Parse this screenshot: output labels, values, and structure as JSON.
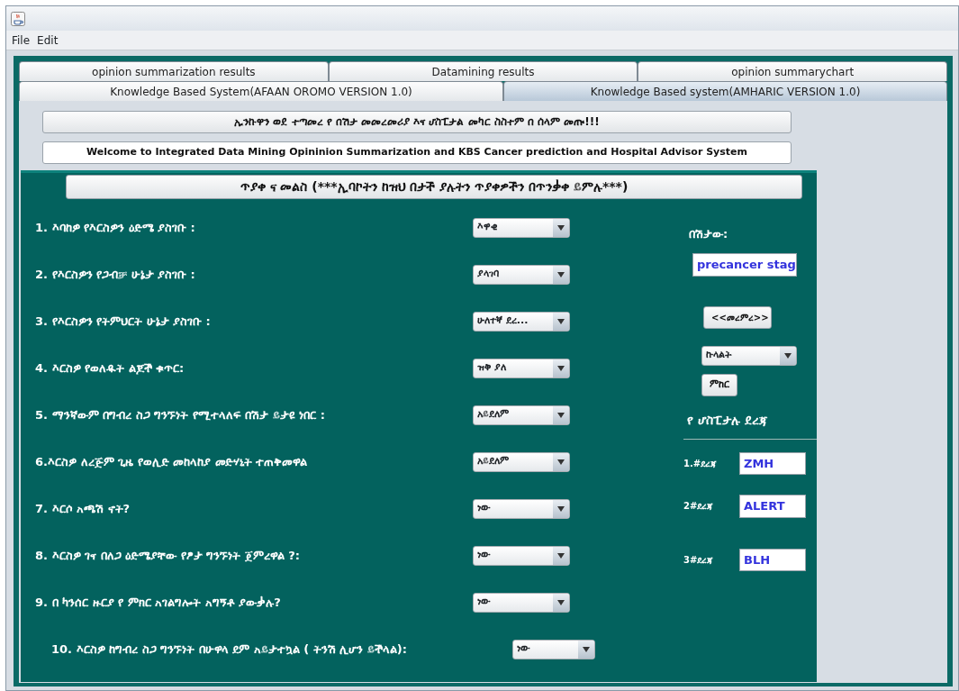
{
  "menu": [
    "File",
    "Edit"
  ],
  "tab_rows": [
    [
      {
        "label": "opinion summarization results",
        "selected": false
      },
      {
        "label": "Datamining results",
        "selected": false
      },
      {
        "label": "opinion summarychart",
        "selected": false
      }
    ],
    [
      {
        "label": "Knowledge Based System(AFAAN OROMO VERSION 1.0)",
        "selected": false
      },
      {
        "label": "Knowledge Based system(AMHARIC VERSION 1.0)",
        "selected": true
      }
    ]
  ],
  "welcome_amharic": "ኢንኩዋን ወደ ተጣመረ የ በሽታ መመረመሪያ እና ሆስፒታል መካር ስስተም በ ሰላም መጡ!!!",
  "welcome_english": "Welcome to Integrated Data Mining Opininion Summarization and KBS Cancer prediction and Hospital Advisor System",
  "form_header": "ጥያቀ ና መልስ (***ኢባኮትን ከዝህ በታች ያሉትን ጥያቀዎችን በጥንቃቀ ይምሉ***)",
  "questions": [
    {
      "label": "1. እባከዎ የእርስዎን ዕድሜ ያስገቡ :",
      "answer": "እዋቂ"
    },
    {
      "label": "2. የእርስዎን የጋብቻ ሁኔታ ያስገቡ :",
      "answer": "ያላገባ"
    },
    {
      "label": "3. የእርስዎን የትምህርት ሁኔታ ያስገቡ :",
      "answer": "ሁለተኛ ደረ..."
    },
    {
      "label": "4. እርስዎ የወለዱት ልጆች ቁጥር:",
      "answer": "ዝቅ ያለ"
    },
    {
      "label": "5. ማንኛውም በግብረ ስጋ ግንኙነት የሚተላለፍ በሽታ ይታዩ ነበር :",
      "answer": "አይደለም"
    },
    {
      "label": "6.እርስዎ ለረጅም ጊዜ የወሊድ መከላከያ መድሃኒት ተጠቅመዋል",
      "answer": "አይደለም"
    },
    {
      "label": "7. እርሶ አጫሽ ኖት?",
      "answer": "ነው"
    },
    {
      "label": "8. እርስዎ ገና በለጋ ዕድሜያቸው የፆታ ግንኙነት ጀምረዋል ?:",
      "answer": "ነው"
    },
    {
      "label": "9. በ ካንሰር ዙርያ የ ምክር አገልግሎት አግኝቶ ያውቃሉ?",
      "answer": "ነው"
    },
    {
      "label": "10.  እርስዎ ከግብረ ስጋ ግንኙነት በሁዋላ ደም አይታተኳል ( ትንሽ ሊሆን ይችላል):",
      "answer": "ነው"
    }
  ],
  "diagnosis": {
    "label": "በሽታው:",
    "value": "precancer stag"
  },
  "diagnose_button": "<<መረምረ>>",
  "region_select": "ኩላልት",
  "advise_button": "ምከር",
  "hospital_heading": "የ ሆስፒታሉ ደረጃ",
  "hospitals": [
    {
      "label": "1.#ደረጃ",
      "value": "ZMH"
    },
    {
      "label": "2#ደረጃ",
      "value": "ALERT"
    },
    {
      "label": "3#ደረጃ",
      "value": "BLH"
    }
  ]
}
